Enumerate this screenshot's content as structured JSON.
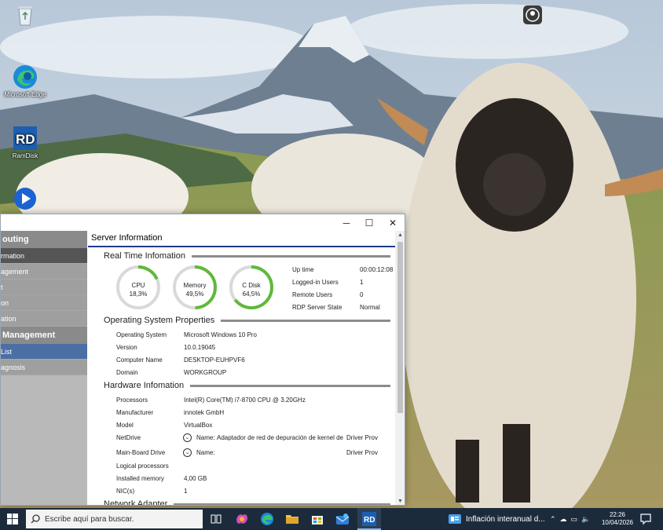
{
  "desktop": {
    "icons": [
      {
        "name": "recycle-bin",
        "label": ""
      },
      {
        "name": "microsoft-edge",
        "label": "Microsoft Edge"
      },
      {
        "name": "ramdisk",
        "label": "RamDisk"
      },
      {
        "name": "media-player",
        "label": ""
      }
    ]
  },
  "window": {
    "buttons": {
      "minimize": "─",
      "maximize": "☐",
      "close": "✕"
    }
  },
  "sidebar": {
    "head1": "outing",
    "items1": [
      "rmation",
      "agement",
      "t",
      "on",
      "ation"
    ],
    "head2": " Management",
    "items2": [
      "List",
      "agnosis"
    ]
  },
  "main": {
    "title": "Server Information",
    "realtime": {
      "title": "Real Time Infomation",
      "gauges": [
        {
          "label": "CPU",
          "value": "18,3%",
          "fraction": 0.183
        },
        {
          "label": "Memory",
          "value": "49,5%",
          "fraction": 0.495
        },
        {
          "label": "C Disk",
          "value": "64,5%",
          "fraction": 0.645
        }
      ],
      "stats": [
        {
          "label": "Up time",
          "value": "00:00:12:08"
        },
        {
          "label": "Logged-in Users",
          "value": "1"
        },
        {
          "label": "Remote Users",
          "value": "0"
        },
        {
          "label": "RDP Server State",
          "value": "Normal"
        }
      ]
    },
    "os": {
      "title": "Operating System Properties",
      "rows": [
        {
          "label": "Operating System",
          "value": "Microsoft Windows 10 Pro"
        },
        {
          "label": "Version",
          "value": "10.0.19045"
        },
        {
          "label": "Computer Name",
          "value": "DESKTOP-EUHPVF6"
        },
        {
          "label": "Domain",
          "value": "WORKGROUP"
        }
      ]
    },
    "hardware": {
      "title": "Hardware Infomation",
      "rows": [
        {
          "label": "Processors",
          "value": "Intel(R) Core(TM) i7-8700 CPU @ 3.20GHz"
        },
        {
          "label": "Manufacturer",
          "value": "innotek GmbH"
        },
        {
          "label": "Model",
          "value": "VirtualBox"
        }
      ],
      "netdrive": {
        "label": "NetDrive",
        "name_label": "Name:",
        "name_value": "Adaptador de red de depuración de kernel de",
        "driver": "Driver Prov"
      },
      "mainboard": {
        "label": "Main-Board Drive",
        "name_label": "Name:",
        "name_value": "",
        "driver": "Driver Prov"
      },
      "rows2": [
        {
          "label": "Logical processors",
          "value": ""
        },
        {
          "label": "Installed memory",
          "value": "4,00 GB"
        },
        {
          "label": "NIC(s)",
          "value": "1"
        }
      ]
    },
    "network_title": "Network Adapter"
  },
  "taskbar": {
    "search_placeholder": "Escribe aquí para buscar.",
    "news": "Inflación interanual d...",
    "time": "22:26",
    "date": "10/04/2026"
  },
  "colors": {
    "gauge_green": "#5fb93a",
    "gauge_track": "#d9d9d9",
    "title_blue": "#1f3a8a",
    "taskbar": "#1c2b3c"
  }
}
